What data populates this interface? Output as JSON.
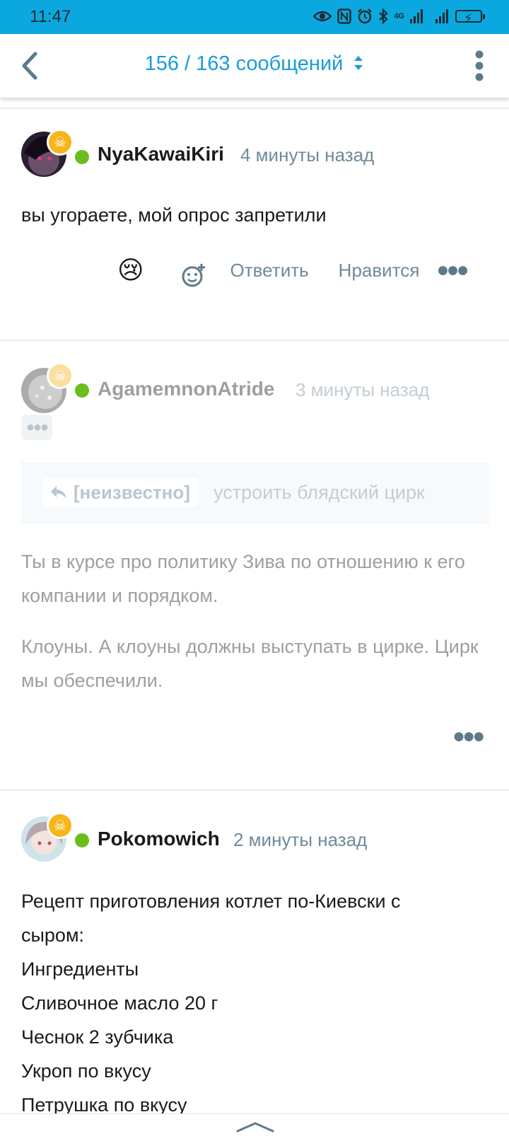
{
  "status_bar": {
    "time": "11:47",
    "icons": [
      "eye-icon",
      "nfc-icon",
      "alarm-icon",
      "bluetooth-icon",
      "signal-4g-icon",
      "signal-icon",
      "battery-charging-icon"
    ],
    "network_label": "4G"
  },
  "header": {
    "title": "156 / 163 сообщений",
    "accent_color": "#1a9cd8"
  },
  "posts": [
    {
      "username": "NyaKawaiKiri",
      "time_ago": "4 минуты назад",
      "text": "вы угораете, мой опрос запретили",
      "reaction_emoji": "😢",
      "reply_label": "Ответить",
      "like_label": "Нравится"
    },
    {
      "username": "AgamemnonAtride",
      "time_ago": "3 минуты назад",
      "quote_author": "[неизвестно]",
      "quote_text": "устроить блядский цирк",
      "paragraphs": [
        "Ты в курсе про политику Зива по отношению к его компании и порядком.",
        "Клоуны. А клоуны должны выступать в цирке. Цирк мы обеспечили."
      ]
    },
    {
      "username": "Pokomowich",
      "time_ago": "2 минуты назад",
      "lines": [
        "Рецепт приготовления котлет по-Киевски с",
        "сыром:",
        "Ингредиенты",
        "Сливочное масло 20 г",
        "Чеснок 2 зубчика",
        "Укроп по вкусу",
        "Петрушка по вкусу"
      ]
    }
  ],
  "colors": {
    "online": "#6bbd1b",
    "badge": "#f7b51a",
    "meta_text": "#6f8a99"
  }
}
